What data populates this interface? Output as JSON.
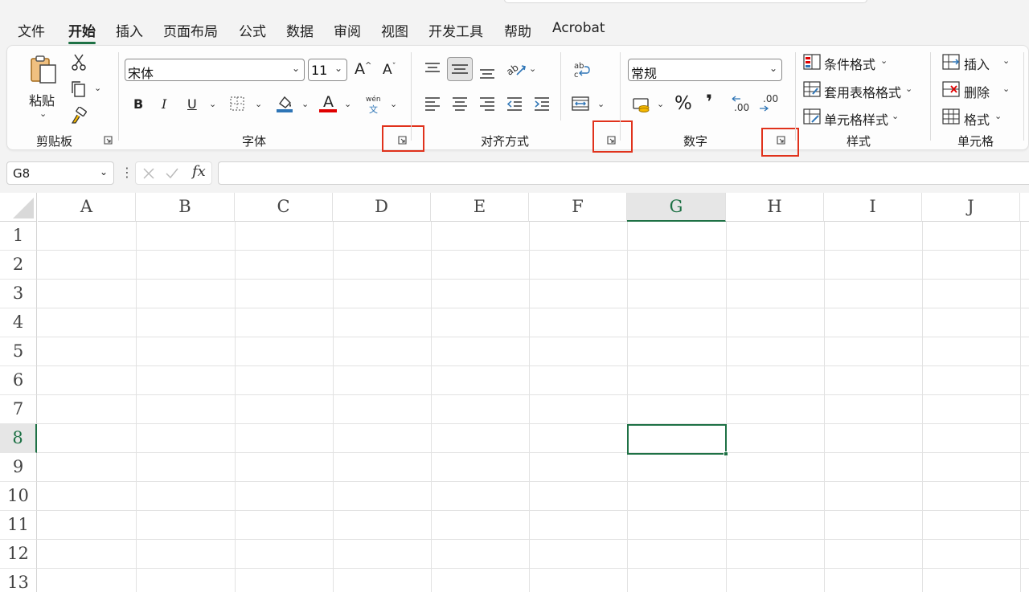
{
  "menu": {
    "tabs": [
      {
        "label": "文件"
      },
      {
        "label": "开始",
        "active": true
      },
      {
        "label": "插入"
      },
      {
        "label": "页面布局"
      },
      {
        "label": "公式"
      },
      {
        "label": "数据"
      },
      {
        "label": "审阅"
      },
      {
        "label": "视图"
      },
      {
        "label": "开发工具"
      },
      {
        "label": "帮助"
      },
      {
        "label": "Acrobat"
      }
    ]
  },
  "ribbon": {
    "clipboard": {
      "paste_label": "粘贴",
      "group_label": "剪贴板",
      "icons": [
        "paste-icon",
        "cut-icon",
        "copy-icon",
        "format-painter-icon"
      ]
    },
    "font": {
      "group_label": "字体",
      "font_name": "宋体",
      "font_size": "11",
      "increase_glyph": "A",
      "decrease_glyph": "A",
      "bold": "B",
      "italic": "I",
      "underline": "U",
      "font_color_glyph": "A",
      "phonetic_top": "wén",
      "phonetic_bottom": "文"
    },
    "alignment": {
      "group_label": "对齐方式"
    },
    "number": {
      "group_label": "数字",
      "format": "常规",
      "percent": "%",
      "comma": "❜",
      "inc_decimal": ".00",
      "dec_decimal": ".00"
    },
    "styles": {
      "group_label": "样式",
      "conditional_format": "条件格式",
      "format_as_table": "套用表格格式",
      "cell_styles": "单元格样式"
    },
    "cells": {
      "group_label": "单元格",
      "insert": "插入",
      "delete": "删除",
      "format": "格式"
    }
  },
  "formula_bar": {
    "name_box": "G8",
    "fx": "fx",
    "formula": ""
  },
  "sheet": {
    "columns": [
      "A",
      "B",
      "C",
      "D",
      "E",
      "F",
      "G",
      "H",
      "I",
      "J"
    ],
    "rows": [
      "1",
      "2",
      "3",
      "4",
      "5",
      "6",
      "7",
      "8",
      "9",
      "10",
      "11",
      "12",
      "13"
    ],
    "selected_cell": "G8"
  },
  "colors": {
    "accent": "#1e7145",
    "highlight_box": "#e0321c",
    "fill_color_bar": "#2e75b6",
    "font_color_bar": "#e00000"
  }
}
